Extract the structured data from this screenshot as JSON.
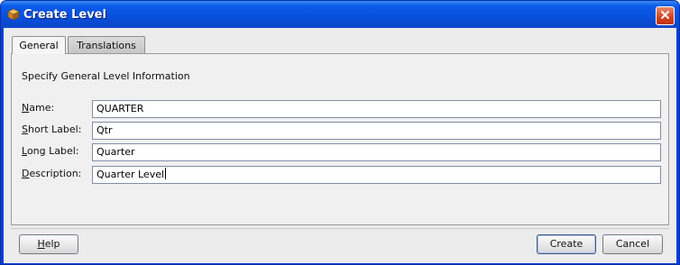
{
  "window": {
    "title": "Create Level",
    "icons": {
      "app": "level-cube-icon",
      "close": "close-icon"
    }
  },
  "tabs": [
    {
      "label": "General",
      "selected": true
    },
    {
      "label": "Translations",
      "selected": false
    }
  ],
  "panel": {
    "heading": "Specify General Level Information",
    "fields": {
      "name": {
        "mnemonic": "N",
        "label_rest": "ame:",
        "value": "QUARTER"
      },
      "short_label": {
        "mnemonic": "S",
        "label_rest": "hort Label:",
        "value": "Qtr"
      },
      "long_label": {
        "mnemonic": "L",
        "label_rest": "ong Label:",
        "value": "Quarter"
      },
      "description": {
        "mnemonic": "D",
        "label_rest": "escription:",
        "value": "Quarter Level",
        "focused": true
      }
    }
  },
  "buttons": {
    "help": {
      "mnemonic": "H",
      "label_rest": "elp"
    },
    "create": {
      "label": "Create",
      "default": true
    },
    "cancel": {
      "label": "Cancel"
    }
  },
  "colors": {
    "titlebar": "#0a4ad0",
    "close_button": "#d5401c",
    "dialog_background": "#ececec"
  }
}
